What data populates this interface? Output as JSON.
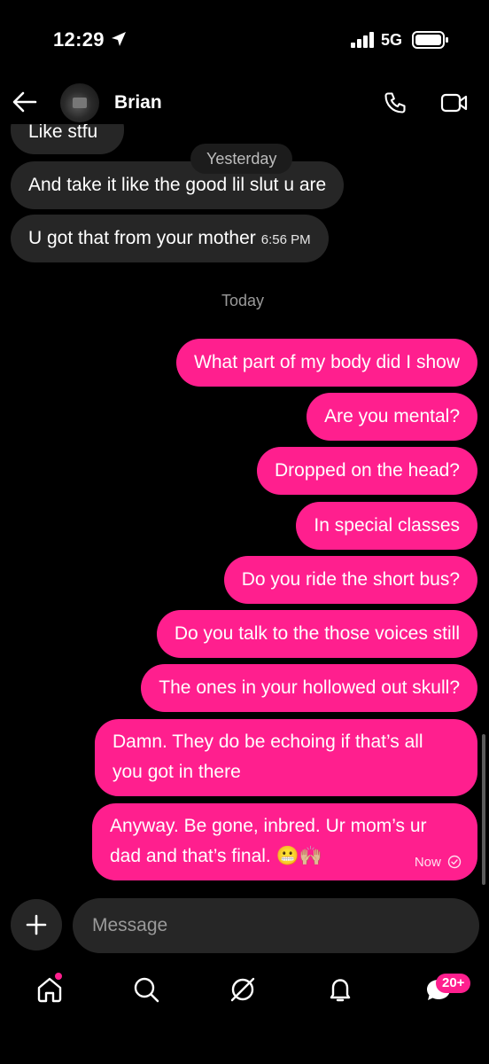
{
  "status_bar": {
    "time": "12:29",
    "network": "5G"
  },
  "header": {
    "contact_name": "Brian"
  },
  "messages": {
    "partial_top": "Like stfu",
    "yesterday_label": "Yesterday",
    "incoming_1": "And take it like the good lil slut u are",
    "incoming_2": "U got that from your mother",
    "incoming_2_time": "6:56 PM",
    "today_label": "Today",
    "out_1": "What part of my body did I show",
    "out_2": "Are you mental?",
    "out_3": "Dropped on the head?",
    "out_4": "In special classes",
    "out_5": "Do you ride the short bus?",
    "out_6": "Do you talk to the those voices still",
    "out_7": "The ones in your hollowed out skull?",
    "out_8_line1": "Damn. They do be echoing if that’s all",
    "out_8_line2": "you got in there",
    "out_9_line1": "Anyway. Be gone, inbred. Ur mom’s ur",
    "out_9_line2": "dad and that’s final. 😬🙌🏼",
    "out_9_status": "Now"
  },
  "composer": {
    "placeholder": "Message"
  },
  "tabbar": {
    "notifications_badge": "20+"
  },
  "colors": {
    "accent": "#ff1f8e",
    "incoming_bubble": "#262626",
    "background": "#000000"
  },
  "icons": [
    "location-arrow-icon",
    "signal-icon",
    "battery-icon",
    "back-arrow-icon",
    "phone-icon",
    "video-icon",
    "plus-icon",
    "home-icon",
    "search-icon",
    "explore-icon",
    "bell-icon",
    "chat-icon",
    "read-check-icon"
  ]
}
